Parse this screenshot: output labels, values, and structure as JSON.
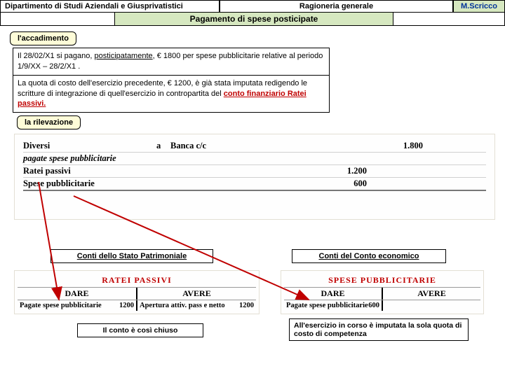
{
  "header": {
    "dept": "Dipartimento di Studi Aziendali e Giusprivatistici",
    "course": "Ragioneria generale",
    "author": "M.Scricco"
  },
  "subtitle": "Pagamento di spese posticipate",
  "tabs": {
    "t1": "l'accadimento",
    "t2": "la rilevazione"
  },
  "para1": {
    "a": "Il 28/02/X1 si pagano, ",
    "b": "posticipatamente",
    "c": ", € 1800 per spese pubblicitarie relative al periodo  1/9/XX – 28/2/X1 ."
  },
  "para2": {
    "a": "La quota di costo dell'esercizio precedente, € 1200, è già stata imputata redigendo le scritture di integrazione di quell'esercizio in contropartita del ",
    "b": "conto finanziario Ratei passivi."
  },
  "journal": {
    "r1": {
      "c1": "Diversi",
      "c2": "a",
      "c3": "Banca c/c",
      "v1": "",
      "v2": "1.800"
    },
    "r2": {
      "c1": "pagate spese pubblicitarie"
    },
    "r3": {
      "c1": "Ratei passivi",
      "v1": "1.200"
    },
    "r4": {
      "c1": "Spese pubblicitarie",
      "v1": "600"
    }
  },
  "panel_sp": "Conti dello Stato Patrimoniale",
  "panel_ce": "Conti del Conto economico",
  "acc_ratei": {
    "title": "RATEI PASSIVI",
    "dare": "DARE",
    "avere": "AVERE",
    "l1a": "Pagate spese pubblicitarie",
    "l1b": "1200",
    "l2a": "Apertura attiv. pass e netto",
    "l2b": "1200"
  },
  "acc_spese": {
    "title": "SPESE PUBBLICITARIE",
    "dare": "DARE",
    "avere": "AVERE",
    "l1a": "Pagate spese pubblicitarie",
    "l1b": "600"
  },
  "note1": "Il  conto è così chiuso",
  "note2": "All'esercizio in corso è imputata la sola quota di costo di competenza"
}
